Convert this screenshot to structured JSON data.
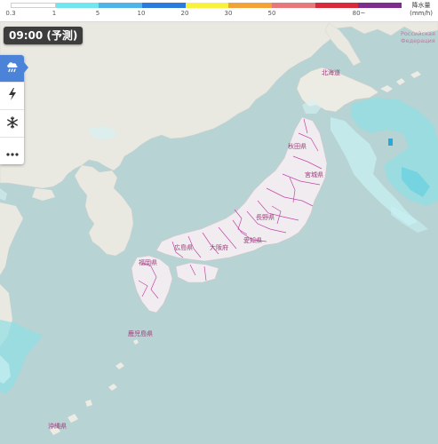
{
  "legend": {
    "ticks": [
      "0.3",
      "1",
      "5",
      "10",
      "20",
      "30",
      "50",
      "80~"
    ],
    "unit_line1": "降水量",
    "unit_line2": "(mm/h)",
    "colors": [
      "#ffffff",
      "#72e6ee",
      "#4fb5e8",
      "#2a7bdc",
      "#f8f23f",
      "#f1a33a",
      "#e6787c",
      "#d92a3b",
      "#7c2d8d"
    ]
  },
  "time_badge": "09:00 (予測)",
  "toolbar": {
    "items": [
      {
        "icon": "rain-cloud-icon",
        "active": true
      },
      {
        "icon": "lightning-icon",
        "active": false
      },
      {
        "icon": "snowflake-icon",
        "active": false
      },
      {
        "icon": "more-icon",
        "active": false
      }
    ]
  },
  "map_labels": {
    "russia_line1": "Российская",
    "russia_line2": "Федерация",
    "hokkaido": "北海道",
    "akita": "秋田県",
    "miyagi": "宮城県",
    "nagano": "長野県",
    "hiroshima": "広島県",
    "aichi": "愛知県",
    "osaka": "大阪府",
    "fukuoka": "福岡県",
    "kagoshima": "鹿児島県",
    "okinawa": "沖縄県"
  }
}
